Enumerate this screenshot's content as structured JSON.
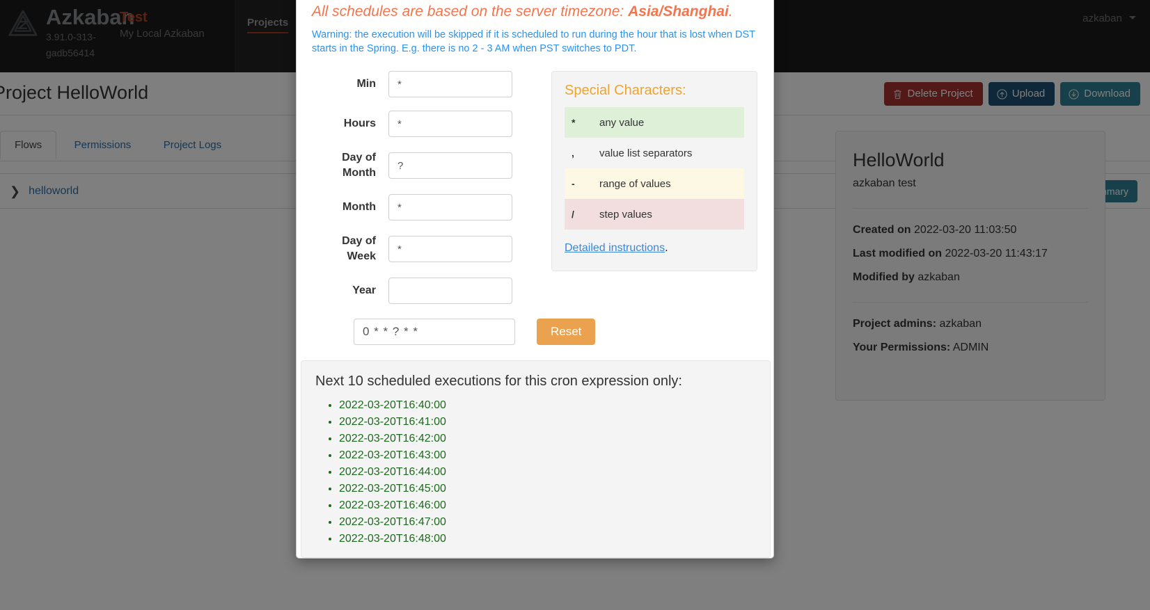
{
  "navbar": {
    "brand": "Azkaban",
    "version": "3.91.0-313-gadb56414",
    "env_title": "Test",
    "env_sub": "My Local Azkaban",
    "tabs": [
      {
        "label": "Projects",
        "active": true
      }
    ],
    "user": "azkaban",
    "logo_icon": "azkaban-logo-icon",
    "caret_icon": "chevron-down-icon"
  },
  "page": {
    "title": "Project HelloWorld",
    "buttons": [
      {
        "label": "Delete Project",
        "icon": "trash-icon",
        "style": "danger"
      },
      {
        "label": "Upload",
        "icon": "upload-icon",
        "style": "primary"
      },
      {
        "label": "Download",
        "icon": "download-icon",
        "style": "info"
      }
    ],
    "tabs": [
      {
        "label": "Flows",
        "active": true
      },
      {
        "label": "Permissions",
        "active": false
      },
      {
        "label": "Project Logs",
        "active": false
      }
    ],
    "flow": {
      "name": "helloworld",
      "chevron_icon": "chevron-down-icon",
      "action_label": "Execution Summary"
    }
  },
  "side_panel": {
    "title": "HelloWorld",
    "subtitle": "azkaban test",
    "created_label": "Created on",
    "created_value": "2022-03-20 11:03:50",
    "modified_label": "Last modified on",
    "modified_value": "2022-03-20 11:43:17",
    "modified_by_label": "Modified by",
    "modified_by_value": "azkaban",
    "admins_label": "Project admins:",
    "admins_value": "azkaban",
    "permissions_label": "Your Permissions:",
    "permissions_value": "ADMIN"
  },
  "modal": {
    "timezone_prefix": "All schedules are based on the server timezone: ",
    "timezone_value": "Asia/Shanghai",
    "timezone_suffix": ".",
    "warning": "Warning: the execution will be skipped if it is scheduled to run during the hour that is lost when DST starts in the Spring. E.g. there is no 2 - 3 AM when PST switches to PDT.",
    "fields": [
      {
        "label": "Min",
        "value": "*",
        "name": "minute"
      },
      {
        "label": "Hours",
        "value": "*",
        "name": "hours"
      },
      {
        "label": "Day of Month",
        "value": "?",
        "name": "day-of-month"
      },
      {
        "label": "Month",
        "value": "*",
        "name": "month"
      },
      {
        "label": "Day of Week",
        "value": "*",
        "name": "day-of-week"
      },
      {
        "label": "Year",
        "value": "",
        "name": "year"
      }
    ],
    "special": {
      "title": "Special Characters:",
      "rows": [
        {
          "char": "*",
          "desc": "any value",
          "tone": "g"
        },
        {
          "char": ",",
          "desc": "value list separators",
          "tone": ""
        },
        {
          "char": "-",
          "desc": "range of values",
          "tone": "w"
        },
        {
          "char": "/",
          "desc": "step values",
          "tone": "r"
        }
      ],
      "link": "Detailed instructions",
      "link_suffix": "."
    },
    "cron_expression": "0 * * ? * *",
    "reset_label": "Reset",
    "next_title": "Next 10 scheduled executions for this cron expression only:",
    "next_executions": [
      "2022-03-20T16:40:00",
      "2022-03-20T16:41:00",
      "2022-03-20T16:42:00",
      "2022-03-20T16:43:00",
      "2022-03-20T16:44:00",
      "2022-03-20T16:45:00",
      "2022-03-20T16:46:00",
      "2022-03-20T16:47:00",
      "2022-03-20T16:48:00"
    ]
  },
  "colors": {
    "accent_orange": "#f4744c",
    "link_blue": "#2b92f0",
    "reset_orange": "#eaa24e",
    "success_green": "#1c6b1c"
  }
}
